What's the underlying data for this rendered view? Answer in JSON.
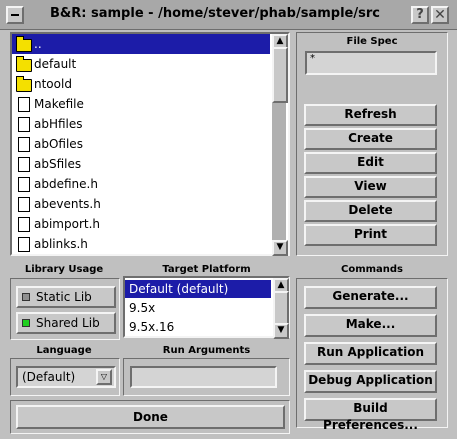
{
  "window": {
    "title": "B&R: sample - /home/stever/phab/sample/src",
    "help_label": "?",
    "close_label": "✕"
  },
  "file_list": {
    "items": [
      {
        "name": "..",
        "type": "folder",
        "selected": true
      },
      {
        "name": "default",
        "type": "folder"
      },
      {
        "name": "ntoold",
        "type": "folder"
      },
      {
        "name": "Makefile",
        "type": "file"
      },
      {
        "name": "abHfiles",
        "type": "file"
      },
      {
        "name": "abOfiles",
        "type": "file"
      },
      {
        "name": "abSfiles",
        "type": "file"
      },
      {
        "name": "abdefine.h",
        "type": "file"
      },
      {
        "name": "abevents.h",
        "type": "file"
      },
      {
        "name": "abimport.h",
        "type": "file"
      },
      {
        "name": "ablinks.h",
        "type": "file"
      }
    ]
  },
  "file_spec": {
    "label": "File Spec",
    "value": "*"
  },
  "file_buttons": [
    "Refresh",
    "Create",
    "Edit",
    "View",
    "Delete",
    "Print"
  ],
  "library_usage": {
    "label": "Library Usage",
    "options": [
      {
        "label": "Static Lib",
        "indicator_color": "#909090"
      },
      {
        "label": "Shared Lib",
        "indicator_color": "#20d020",
        "selected": true
      }
    ]
  },
  "target_platform": {
    "label": "Target Platform",
    "items": [
      {
        "label": "Default (default)",
        "selected": true
      },
      {
        "label": "9.5x"
      },
      {
        "label": "9.5x.16"
      }
    ]
  },
  "commands": {
    "label": "Commands",
    "buttons": [
      "Generate...",
      "Make...",
      "Run Application",
      "Debug Application",
      "Build Preferences..."
    ]
  },
  "language": {
    "label": "Language",
    "value": "(Default)"
  },
  "run_arguments": {
    "label": "Run Arguments",
    "value": ""
  },
  "done_label": "Done",
  "colors": {
    "background": "#c0c0c0",
    "selection": "#1c1ca8",
    "folder": "#f4e000",
    "shared_indicator": "#20d020"
  }
}
